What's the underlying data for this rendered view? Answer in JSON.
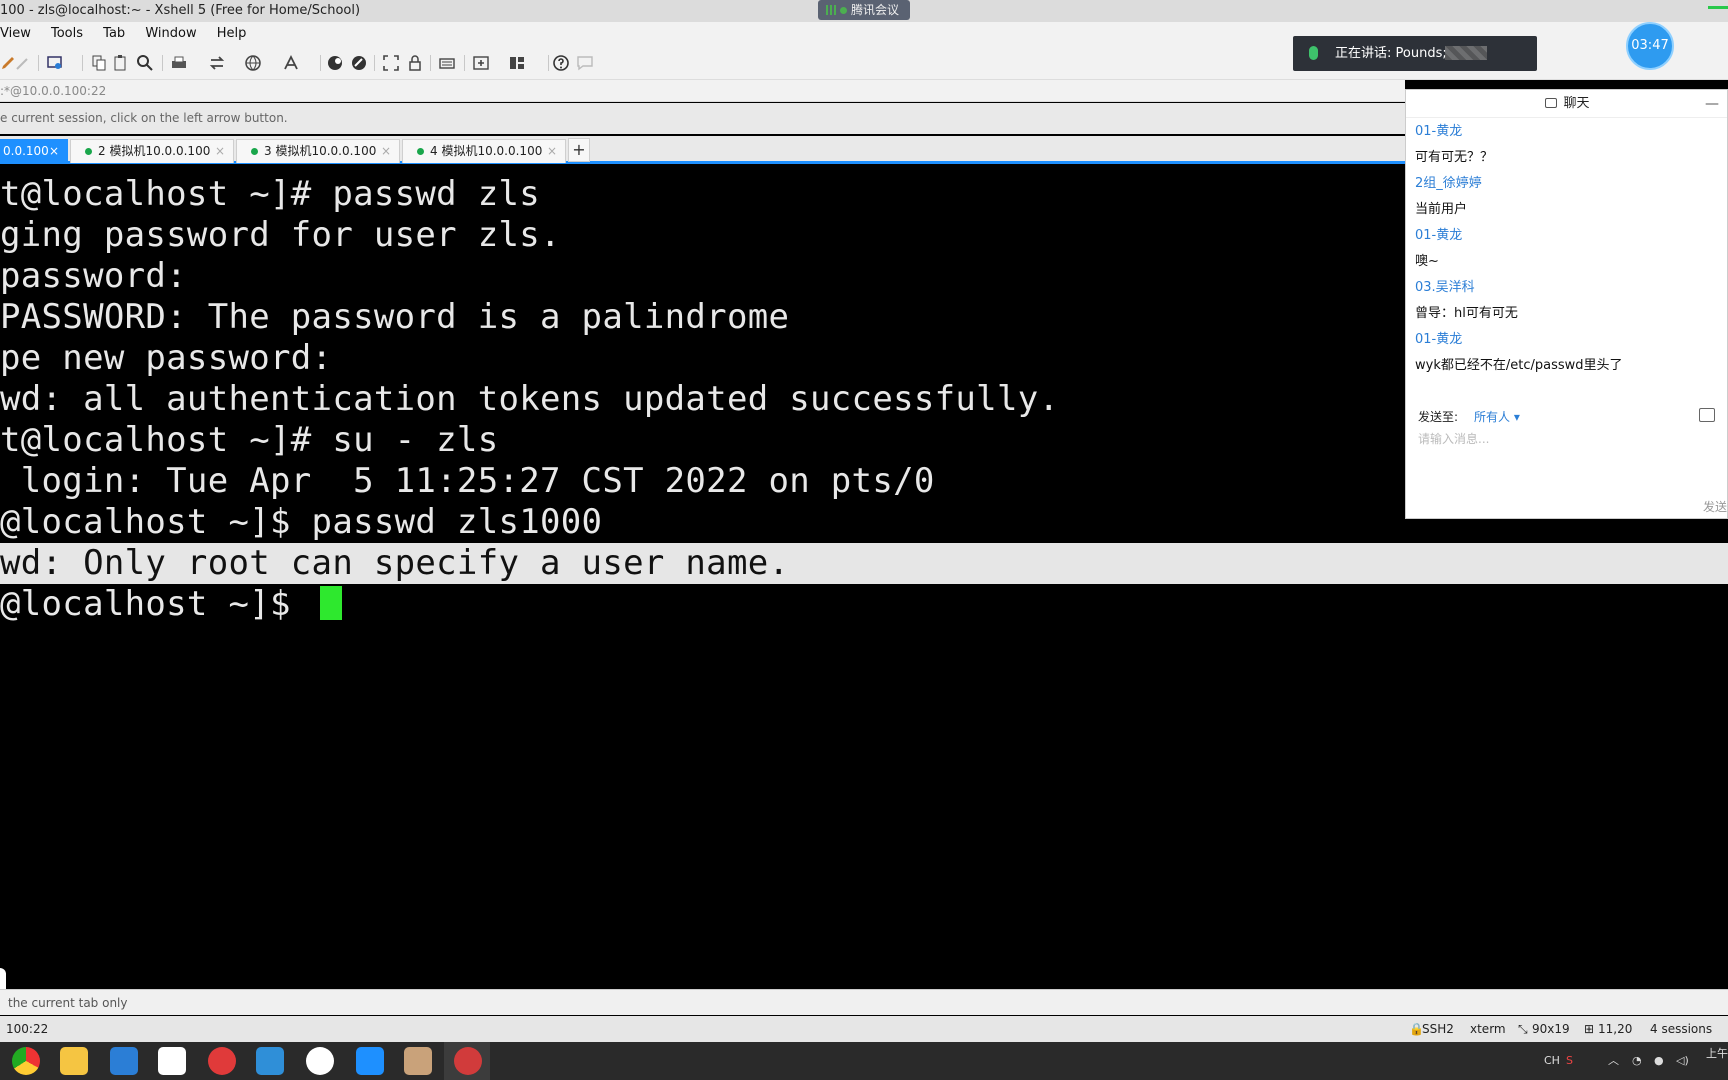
{
  "window": {
    "title": "100 - zls@localhost:~ - Xshell 5 (Free for Home/School)",
    "meeting_label": "腾讯会议"
  },
  "menu": [
    "View",
    "Tools",
    "Tab",
    "Window",
    "Help"
  ],
  "address": ":*@10.0.0.100:22",
  "hint": "e current session, click on the left arrow button.",
  "tabs": [
    {
      "label": "0.0.100",
      "active": true
    },
    {
      "label": "2 模拟机10.0.0.100",
      "active": false
    },
    {
      "label": "3 模拟机10.0.0.100",
      "active": false
    },
    {
      "label": "4 模拟机10.0.0.100",
      "active": false
    }
  ],
  "tab_add": "+",
  "terminal": {
    "lines": [
      "t@localhost ~]# passwd zls",
      "ging password for user zls.",
      "password:",
      "PASSWORD: The password is a palindrome",
      "pe new password:",
      "wd: all authentication tokens updated successfully.",
      "t@localhost ~]# su - zls",
      " login: Tue Apr  5 11:25:27 CST 2022 on pts/0",
      "@localhost ~]$ passwd zls1000",
      "wd: Only root can specify a user name.",
      "@localhost ~]$ "
    ]
  },
  "scope": "the current tab only",
  "status": {
    "address": "100:22",
    "protocol": "SSH2",
    "term": "xterm",
    "size": "90x19",
    "cursor": "11,20",
    "sessions": "4 sessions"
  },
  "meeting": {
    "speaking": "正在讲话: Pounds;",
    "timer": "03:47"
  },
  "chat": {
    "title": "聊天",
    "messages": [
      {
        "sender": "01-黄龙",
        "text": "可有可无？？"
      },
      {
        "sender": "2组_徐婷婷",
        "text": "当前用户"
      },
      {
        "sender": "01-黄龙",
        "text": "噢~"
      },
      {
        "sender": "03.吴洋科",
        "text": "曾导：hl可有可无"
      },
      {
        "sender": "01-黄龙",
        "text": "wyk都已经不在/etc/passwd里头了"
      }
    ],
    "send_to_label": "发送至:",
    "send_to_value": "所有人 ▾",
    "input_placeholder": "请输入消息...",
    "send_button": "发送"
  },
  "tray": {
    "ime": "CH",
    "clock": "上午"
  },
  "colors": {
    "accent": "#1e90ff",
    "cursor": "#2ee82e",
    "chat_sender": "#2b7ed6"
  }
}
